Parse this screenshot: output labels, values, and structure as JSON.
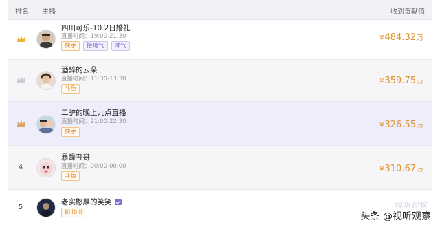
{
  "header": {
    "rank": "排名",
    "host": "主播",
    "gift": "收到贡献值"
  },
  "rows": [
    {
      "rank": "",
      "rank_icon": "gold-crown-icon",
      "name": "四川可乐-10.2日婚礼",
      "time": "直播时间：19:00-21:30",
      "tags": [
        "快手",
        "接地气",
        "帅气"
      ],
      "currency": "¥",
      "amount": "484.32",
      "unit": "万"
    },
    {
      "rank": "",
      "rank_icon": "silver-crown-icon",
      "name": "酒醉的云朵",
      "time": "直播时间：11:30-13:30",
      "tags": [
        "斗鱼"
      ],
      "currency": "¥",
      "amount": "359.75",
      "unit": "万"
    },
    {
      "rank": "",
      "rank_icon": "bronze-crown-icon",
      "name": "二驴的晚上九点直播",
      "time": "直播时间：21:00-22:30",
      "tags": [
        "快手"
      ],
      "currency": "¥",
      "amount": "326.55",
      "unit": "万"
    },
    {
      "rank": "4",
      "name": "暴躁丑哥",
      "time": "直播时间：00:00-00:00",
      "tags": [
        "斗鱼"
      ],
      "currency": "¥",
      "amount": "310.67",
      "unit": "万"
    },
    {
      "rank": "5",
      "name": "老实憨厚的笑笑",
      "verified_icon": "verified-badge-icon",
      "tags": [
        "Bilibili"
      ]
    }
  ],
  "watermark": "头条 @视听观察",
  "watermark_faint": "视听观察",
  "colors": {
    "accent": "#e0922f",
    "tag_purple": "#7b6fd3",
    "highlight_row": "#eeedfb"
  }
}
